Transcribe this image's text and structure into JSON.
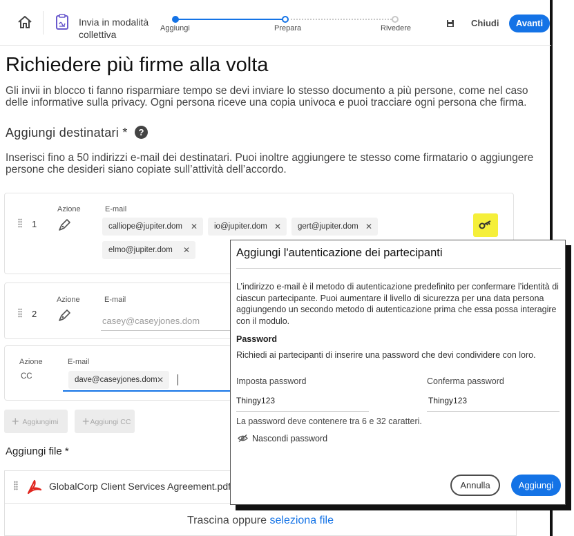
{
  "header": {
    "app_title": "Invia in modalità collettiva",
    "steps": [
      {
        "label": "Aggiungi",
        "state": "done"
      },
      {
        "label": "Prepara",
        "state": "current"
      },
      {
        "label": "Rivedere",
        "state": "todo"
      }
    ],
    "close_label": "Chiudi",
    "next_label": "Avanti"
  },
  "main": {
    "title": "Richiedere più firme alla volta",
    "intro": "Gli invii in blocco ti fanno risparmiare tempo se devi inviare lo stesso documento a più persone, come nel caso delle informative sulla privacy. Ogni persona riceve una copia univoca e puoi tracciare ogni persona che firma.",
    "recipients_title": "Aggiungi destinatari",
    "required_mark": "*",
    "help_glyph": "?",
    "recipients_desc": "Inserisci fino a 50 indirizzi e-mail dei destinatari. Puoi inoltre aggiungere te stesso come firmatario o aggiungere persone che desideri siano copiate sull’attività dell’accordo."
  },
  "recipients": [
    {
      "order": "1",
      "action_label": "Azione",
      "email_label": "E-mail",
      "emails": [
        "calliope@jupiter.dom",
        "io@jupiter.dom",
        "gert@jupiter.dom",
        "elmo@jupiter.dom"
      ]
    },
    {
      "order": "2",
      "action_label": "Azione",
      "email_label": "E-mail",
      "email_placeholder": "casey@caseyjones.dom"
    },
    {
      "action_label": "Azione",
      "email_label": "E-mail",
      "action_value": "CC",
      "emails": [
        "dave@caseyjones.dom"
      ]
    }
  ],
  "add_buttons": {
    "add_me": "Aggiungimi",
    "add_cc": "Aggiungi CC"
  },
  "files": {
    "title": "Aggiungi file",
    "required_mark": "*",
    "items": [
      "GlobalCorp Client Services Agreement.pdf"
    ],
    "drop_text": "Trascina oppure",
    "drop_link": "seleziona file"
  },
  "modal": {
    "title": "Aggiungi l'autenticazione dei partecipanti",
    "desc": "L’indirizzo e-mail è il metodo di autenticazione predefinito per confermare l’identità di ciascun partecipante. Puoi aumentare il livello di sicurezza per una data persona aggiungendo un secondo metodo di autenticazione prima che essa possa interagire con il modulo.",
    "password_title": "Password",
    "password_desc": "Richiedi ai partecipanti di inserire una password che devi condividere con loro.",
    "set_password_label": "Imposta password",
    "set_password_value": "Thingy123",
    "confirm_password_label": "Conferma password",
    "confirm_password_value": "Thingy123",
    "hint": "La password deve contenere tra 6 e 32 caratteri.",
    "hide_password": "Nascondi password",
    "cancel_label": "Annulla",
    "add_label": "Aggiungi"
  },
  "colors": {
    "accent": "#1473e6",
    "key_highlight": "#f5ef3a",
    "pdf_red": "#e0261f"
  }
}
